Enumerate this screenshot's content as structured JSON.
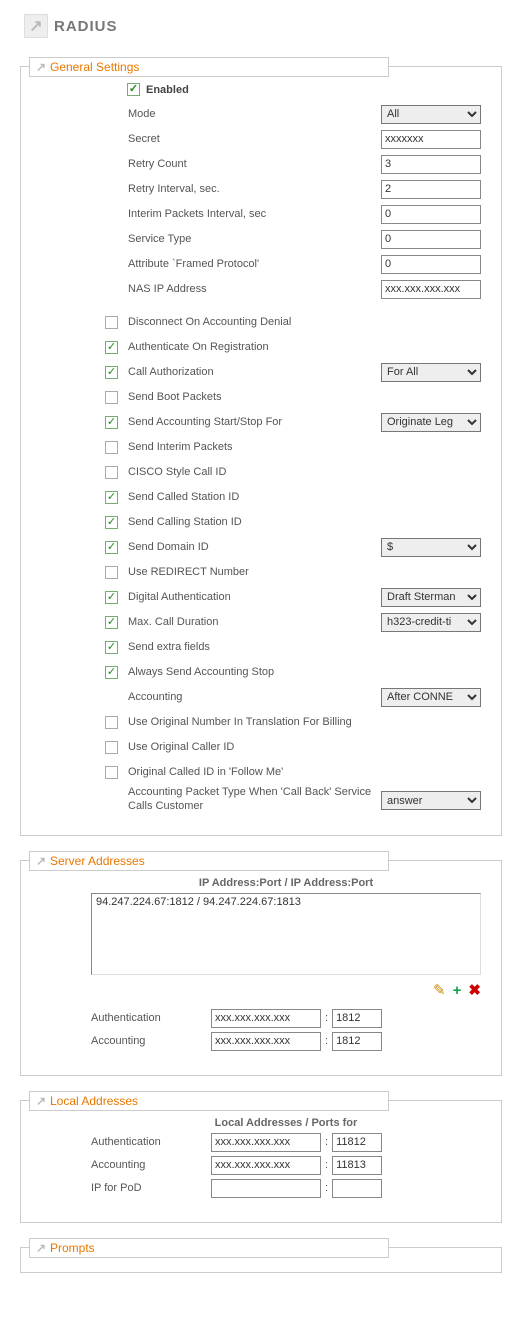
{
  "pageTitle": "RADIUS",
  "sections": {
    "general": "General Settings",
    "server": "Server Addresses",
    "local": "Local Addresses",
    "prompts": "Prompts"
  },
  "enabledLabel": "Enabled",
  "general": {
    "mode": {
      "label": "Mode",
      "value": "All"
    },
    "secret": {
      "label": "Secret",
      "value": "xxxxxxx"
    },
    "retryCount": {
      "label": "Retry Count",
      "value": "3"
    },
    "retryInterval": {
      "label": "Retry Interval, sec.",
      "value": "2"
    },
    "interim": {
      "label": "Interim Packets Interval, sec",
      "value": "0"
    },
    "serviceType": {
      "label": "Service Type",
      "value": "0"
    },
    "framedProtocol": {
      "label": "Attribute `Framed Protocol'",
      "value": "0"
    },
    "nasIp": {
      "label": "NAS IP Address",
      "value": "xxx.xxx.xxx.xxx"
    },
    "disconnectDenial": {
      "label": "Disconnect On Accounting Denial",
      "checked": false
    },
    "authOnReg": {
      "label": "Authenticate On Registration",
      "checked": true
    },
    "callAuth": {
      "label": "Call Authorization",
      "checked": true,
      "value": "For All"
    },
    "sendBoot": {
      "label": "Send Boot Packets",
      "checked": false
    },
    "sendAcctStartStop": {
      "label": "Send Accounting Start/Stop For",
      "checked": true,
      "value": "Originate Leg"
    },
    "sendInterim": {
      "label": "Send Interim Packets",
      "checked": false
    },
    "ciscoCallId": {
      "label": "CISCO Style Call ID",
      "checked": false
    },
    "sendCalled": {
      "label": "Send Called Station ID",
      "checked": true
    },
    "sendCalling": {
      "label": "Send Calling Station ID",
      "checked": true
    },
    "sendDomain": {
      "label": "Send Domain ID",
      "checked": true,
      "value": "$"
    },
    "useRedirect": {
      "label": "Use REDIRECT Number",
      "checked": false
    },
    "digitalAuth": {
      "label": "Digital Authentication",
      "checked": true,
      "value": "Draft Sterman"
    },
    "maxCallDur": {
      "label": "Max. Call Duration",
      "checked": true,
      "value": "h323-credit-ti"
    },
    "sendExtra": {
      "label": "Send extra fields",
      "checked": true
    },
    "alwaysStop": {
      "label": "Always Send Accounting Stop",
      "checked": true
    },
    "accounting": {
      "label": "Accounting",
      "value": "After CONNE"
    },
    "useOrigBilling": {
      "label": "Use Original Number In Translation For Billing",
      "checked": false
    },
    "useOrigCaller": {
      "label": "Use Original Caller ID",
      "checked": false
    },
    "origCalledFollow": {
      "label": "Original Called ID in 'Follow Me'",
      "checked": false
    },
    "acctPacketCallback": {
      "label": "Accounting Packet Type When 'Call Back' Service Calls Customer",
      "value": "answer"
    }
  },
  "server": {
    "header": "IP Address:Port / IP Address:Port",
    "list": "94.247.224.67:1812 / 94.247.224.67:1813",
    "authLabel": "Authentication",
    "acctLabel": "Accounting",
    "authIp": "xxx.xxx.xxx.xxx",
    "authPort": "1812",
    "acctIp": "xxx.xxx.xxx.xxx",
    "acctPort": "1812"
  },
  "local": {
    "header": "Local Addresses / Ports for",
    "authLabel": "Authentication",
    "acctLabel": "Accounting",
    "podLabel": "IP for PoD",
    "authIp": "xxx.xxx.xxx.xxx",
    "authPort": "11812",
    "acctIp": "xxx.xxx.xxx.xxx",
    "acctPort": "11813",
    "podIp": "",
    "podPort": ""
  }
}
